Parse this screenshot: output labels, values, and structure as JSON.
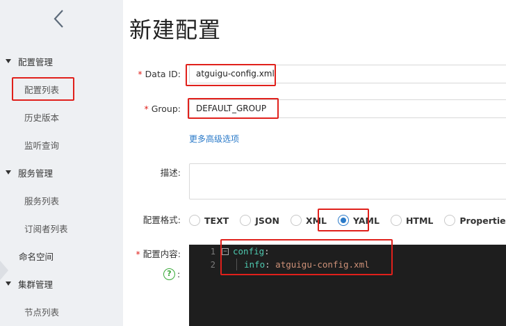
{
  "sidebar": {
    "groups": [
      {
        "label": "配置管理",
        "items": [
          "配置列表",
          "历史版本",
          "监听查询"
        ]
      },
      {
        "label": "服务管理",
        "items": [
          "服务列表",
          "订阅者列表"
        ]
      },
      {
        "plain_label": "命名空间"
      },
      {
        "label": "集群管理",
        "items": [
          "节点列表"
        ]
      }
    ],
    "active_item": "配置列表"
  },
  "page": {
    "title": "新建配置"
  },
  "form": {
    "data_id": {
      "label": "Data ID:",
      "value": "atguigu-config.xml"
    },
    "group": {
      "label": "Group:",
      "value": "DEFAULT_GROUP"
    },
    "advanced_link": "更多高级选项",
    "description": {
      "label": "描述:"
    },
    "format": {
      "label": "配置格式:",
      "options": [
        "TEXT",
        "JSON",
        "XML",
        "YAML",
        "HTML",
        "Properties"
      ],
      "selected": "YAML"
    },
    "content": {
      "label": "配置内容:",
      "help_colon": ":",
      "lines": [
        {
          "num": "1",
          "key": "config",
          "sep": ":",
          "value": ""
        },
        {
          "num": "2",
          "key": "info",
          "sep": ":",
          "value": " atguigu-config.xml"
        }
      ]
    }
  },
  "colors": {
    "highlight": "#e0201b",
    "accent": "#2a7ac9",
    "required": "#e0201b"
  }
}
